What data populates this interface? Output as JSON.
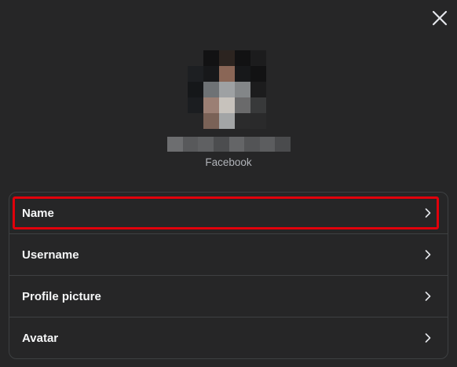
{
  "dialog": {
    "close_icon": "close-icon",
    "platform_label": "Facebook"
  },
  "menu": {
    "items": [
      {
        "label": "Name",
        "icon": "chevron-right-icon",
        "highlighted": true
      },
      {
        "label": "Username",
        "icon": "chevron-right-icon",
        "highlighted": false
      },
      {
        "label": "Profile picture",
        "icon": "chevron-right-icon",
        "highlighted": false
      },
      {
        "label": "Avatar",
        "icon": "chevron-right-icon",
        "highlighted": false
      }
    ]
  },
  "colors": {
    "background": "#262627",
    "divider": "#3e4042",
    "highlight_border": "#e0000b",
    "text_primary": "#f5f6f7",
    "text_secondary": "#b0b3b8"
  }
}
